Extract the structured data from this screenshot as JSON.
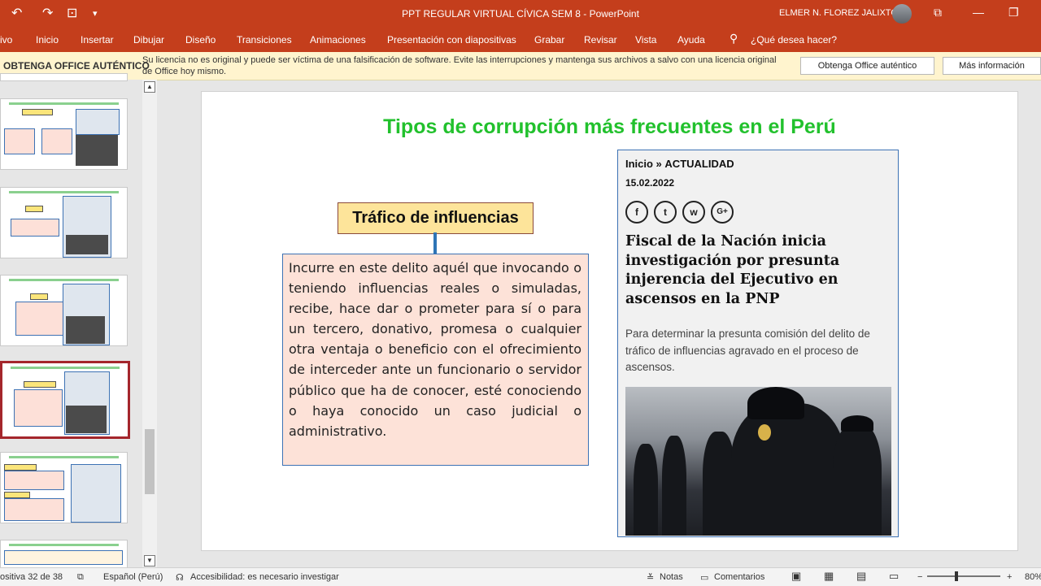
{
  "titlebar": {
    "title": "PPT REGULAR VIRTUAL CÍVICA SEM 8  -  PowerPoint",
    "user": "ELMER N. FLOREZ JALIXTO"
  },
  "ribbon": {
    "tabs": [
      "ivo",
      "Inicio",
      "Insertar",
      "Dibujar",
      "Diseño",
      "Transiciones",
      "Animaciones",
      "Presentación con diapositivas",
      "Grabar",
      "Revisar",
      "Vista",
      "Ayuda"
    ],
    "tell_me": "¿Qué desea hacer?"
  },
  "license_bar": {
    "heading": "OBTENGA OFFICE AUTÉNTICO",
    "message": "Su licencia no es original y puede ser víctima de una falsificación de software. Evite las interrupciones y mantenga sus archivos a salvo con una licencia original de Office hoy mismo.",
    "button_primary": "Obtenga Office auténtico",
    "button_secondary": "Más información"
  },
  "slide": {
    "title": "Tipos de corrupción más frecuentes en el Perú",
    "label": "Tráfico de influencias",
    "definition": "Incurre en este delito aquél que invocando o teniendo influencias reales o simuladas, recibe, hace dar o prometer para sí o para un tercero, donativo, promesa o cualquier otra ventaja o beneficio con el ofrecimiento de interceder ante un funcionario o servidor público que ha de conocer, esté conociendo o haya conocido un caso judicial o administrativo.",
    "article": {
      "crumb_home": "Inicio »",
      "crumb_section": "ACTUALIDAD",
      "date": "15.02.2022",
      "social": [
        "f",
        "t",
        "w",
        "G+"
      ],
      "headline": "Fiscal de la Nación inicia investigación por presunta injerencia del Ejecutivo en ascensos en la PNP",
      "lead": "Para determinar la presunta comisión del delito de tráfico de influencias agravado en el proceso de ascensos."
    }
  },
  "statusbar": {
    "slide_position": "ositiva 32 de 38",
    "language": "Español (Perú)",
    "accessibility": "Accesibilidad: es necesario investigar",
    "notes": "Notas",
    "comments": "Comentarios",
    "zoom": "80%"
  },
  "colors": {
    "accent": "#c43e1c",
    "title_green": "#22c12d",
    "label_yellow": "#fde49a",
    "box_pink": "#fde2d8",
    "border_blue": "#3d72b4"
  }
}
